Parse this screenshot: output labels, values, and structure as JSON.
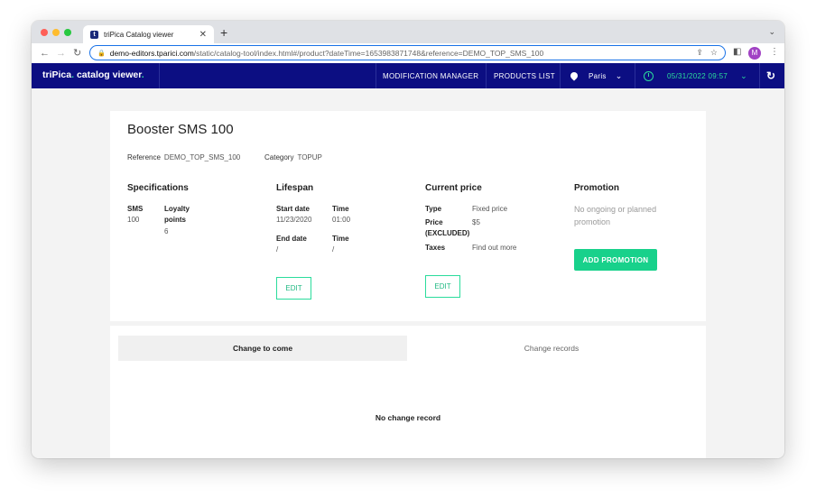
{
  "browser": {
    "tab_title": "triPica Catalog viewer",
    "tab_favicon": "t",
    "url_host": "demo-editors.tparici.com",
    "url_path": "/static/catalog-tool/index.html#/product?dateTime=1653983871748&reference=DEMO_TOP_SMS_100",
    "avatar_initial": "M",
    "icons": [
      "back-icon",
      "forward-icon",
      "reload-icon",
      "lock-icon",
      "share-icon",
      "star-icon",
      "sidepanel-icon",
      "more-icon"
    ]
  },
  "appbar": {
    "brand_name": "triPica",
    "brand_suffix": "catalog viewer",
    "nav_modification": "MODIFICATION MANAGER",
    "nav_products": "PRODUCTS LIST",
    "location": "Paris",
    "datetime": "05/31/2022 09:57",
    "colors": {
      "bar": "#0c0e82",
      "accent": "#2bdc9c"
    }
  },
  "product": {
    "title": "Booster SMS 100",
    "reference_label": "Reference",
    "reference_value": "DEMO_TOP_SMS_100",
    "category_label": "Category",
    "category_value": "TOPUP"
  },
  "specifications": {
    "title": "Specifications",
    "sms_label": "SMS",
    "sms_value": "100",
    "loyalty_label_1": "Loyalty",
    "loyalty_label_2": "points",
    "loyalty_value": "6"
  },
  "lifespan": {
    "title": "Lifespan",
    "start_label": "Start date",
    "start_value": "11/23/2020",
    "start_time_label": "Time",
    "start_time_value": "01:00",
    "end_label": "End date",
    "end_value": "/",
    "end_time_label": "Time",
    "end_time_value": "/",
    "edit_label": "EDIT"
  },
  "price": {
    "title": "Current price",
    "type_label": "Type",
    "type_value": "Fixed price",
    "price_label_1": "Price",
    "price_label_2": "(EXCLUDED)",
    "price_value": "$5",
    "taxes_label": "Taxes",
    "taxes_value": "Find out more",
    "edit_label": "EDIT"
  },
  "promotion": {
    "title": "Promotion",
    "empty_text": "No ongoing or planned promotion",
    "add_label": "ADD PROMOTION",
    "button_color": "#18d18b"
  },
  "changes": {
    "tab_to_come": "Change to come",
    "tab_records": "Change records",
    "empty_text": "No change record"
  }
}
